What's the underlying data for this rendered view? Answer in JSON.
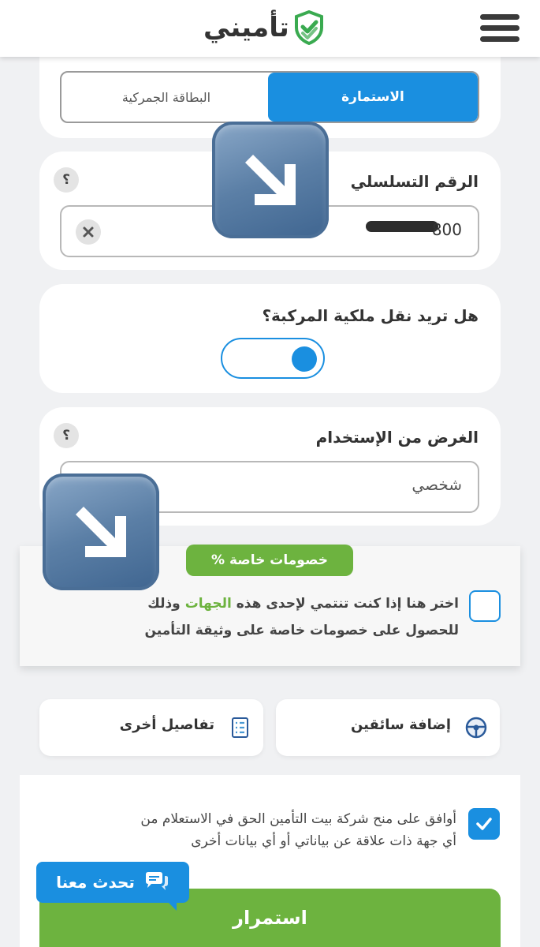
{
  "header": {
    "logo_text": "تأميني",
    "menu_icon": "hamburger-icon",
    "brand_color": "#3aaa50"
  },
  "document_type": {
    "active_label": "الاستمارة",
    "inactive_label": "البطاقة الجمركية"
  },
  "serial": {
    "title": "الرقم التسلسلي",
    "help": "؟",
    "value": "800",
    "clear_icon": "close-icon"
  },
  "transfer": {
    "question": "هل تريد نقل ملكية المركبة؟",
    "toggle_on": true
  },
  "purpose": {
    "title": "الغرض من الإستخدام",
    "help": "؟",
    "value": "شخصي"
  },
  "discounts": {
    "badge": "خصومات خاصة %",
    "line1_pre": "اختر هنا إذا كنت تنتمي لإحدى هذه",
    "line1_link": "الجهات",
    "line1_post": "وذلك",
    "line2": "للحصول على خصومات خاصة على وثيقة التأمين",
    "checked": false
  },
  "tiles": {
    "add_drivers": "إضافة سائقين",
    "other_details": "تفاصيل أخرى"
  },
  "consent": {
    "line1": "أوافق على منح شركة بيت التأمين الحق في الاستعلام من",
    "line2": "أي جهة ذات علاقة عن بياناتي أو أي بيانات أخرى",
    "checked": true
  },
  "chat": {
    "label": "تحدث معنا"
  },
  "continue_button": "استمرار",
  "colors": {
    "primary_blue": "#1a8fe0",
    "green": "#6db33f"
  }
}
